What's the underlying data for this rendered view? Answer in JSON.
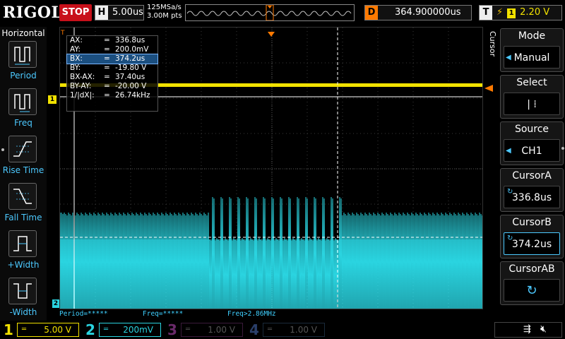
{
  "brand": "RIGOL",
  "run_state": "STOP",
  "timebase": {
    "key": "H",
    "value": "5.00us"
  },
  "sampling": {
    "rate": "125MSa/s",
    "points": "3.00M pts"
  },
  "delay": {
    "key": "D",
    "value": "364.900000us"
  },
  "trigger": {
    "key": "T",
    "channel": "1",
    "level": "2.20 V"
  },
  "left_menu": {
    "title": "Horizontal",
    "items": [
      {
        "label": "Period"
      },
      {
        "label": "Freq"
      },
      {
        "label": "Rise Time"
      },
      {
        "label": "Fall Time"
      },
      {
        "label": "+Width"
      },
      {
        "label": "-Width"
      }
    ]
  },
  "cursor_table": {
    "rows": [
      {
        "key": "AX:",
        "eq": "=",
        "value": "336.8us"
      },
      {
        "key": "AY:",
        "eq": "=",
        "value": "200.0mV"
      },
      {
        "key": "BX:",
        "eq": "=",
        "value": "374.2us"
      },
      {
        "key": "BY:",
        "eq": "=",
        "value": "-19.80 V"
      },
      {
        "key": "BX-AX:",
        "eq": "=",
        "value": "37.40us"
      },
      {
        "key": "BY-AY:",
        "eq": "=",
        "value": "-20.00 V"
      },
      {
        "key": "1/|dX|:",
        "eq": "=",
        "value": "26.74kHz"
      }
    ],
    "selected_row": 2
  },
  "status_line": {
    "period": "Period=*****",
    "freq": "Freq=*****",
    "freq2": "Freq>2.86MHz"
  },
  "right_menu": {
    "title": "Cursor",
    "items": [
      {
        "title": "Mode",
        "value": "Manual"
      },
      {
        "title": "Select",
        "value": "|  ⁞"
      },
      {
        "title": "Source",
        "value": "CH1"
      },
      {
        "title": "CursorA",
        "value": "336.8us"
      },
      {
        "title": "CursorB",
        "value": "374.2us"
      },
      {
        "title": "CursorAB",
        "value": "↻"
      }
    ]
  },
  "channels": [
    {
      "num": "1",
      "scale": "5.00 V",
      "color": "#f2e200",
      "active": true
    },
    {
      "num": "2",
      "scale": "200mV",
      "color": "#2ad4e0",
      "active": true
    },
    {
      "num": "3",
      "scale": "1.00 V",
      "color": "#d43ad4",
      "active": false
    },
    {
      "num": "4",
      "scale": "1.00 V",
      "color": "#3a7bd4",
      "active": false
    }
  ],
  "markers": {
    "ch1": "1",
    "ch2": "2",
    "trig_pos": "T"
  },
  "colors": {
    "ch1": "#f2e200",
    "ch2": "#2ad4e0",
    "cursor": "#ffffff",
    "accent": "#4cc9ff"
  }
}
